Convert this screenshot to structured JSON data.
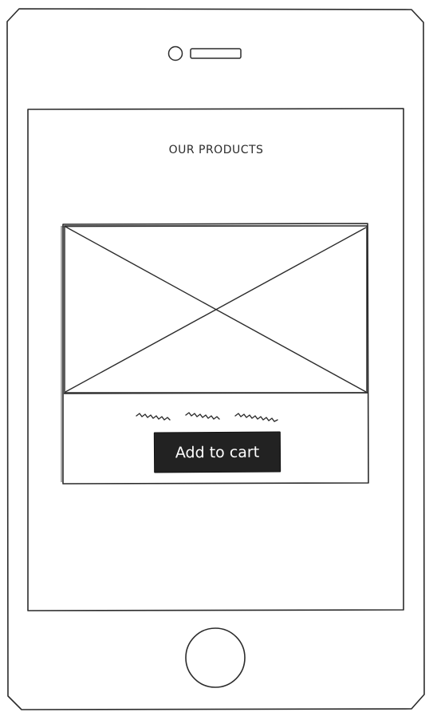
{
  "header": {
    "title": "OUR PRODUCTS"
  },
  "product_card": {
    "image_placeholder": "image-placeholder",
    "description_placeholder": "squiggle-text",
    "add_to_cart_label": "Add to cart"
  },
  "device": {
    "camera_icon": "camera-icon",
    "speaker_icon": "speaker-icon",
    "home_button_icon": "home-button-icon"
  },
  "colors": {
    "stroke": "#2b2b2b",
    "button_bg": "#222222",
    "button_text": "#ffffff",
    "background": "#ffffff"
  }
}
